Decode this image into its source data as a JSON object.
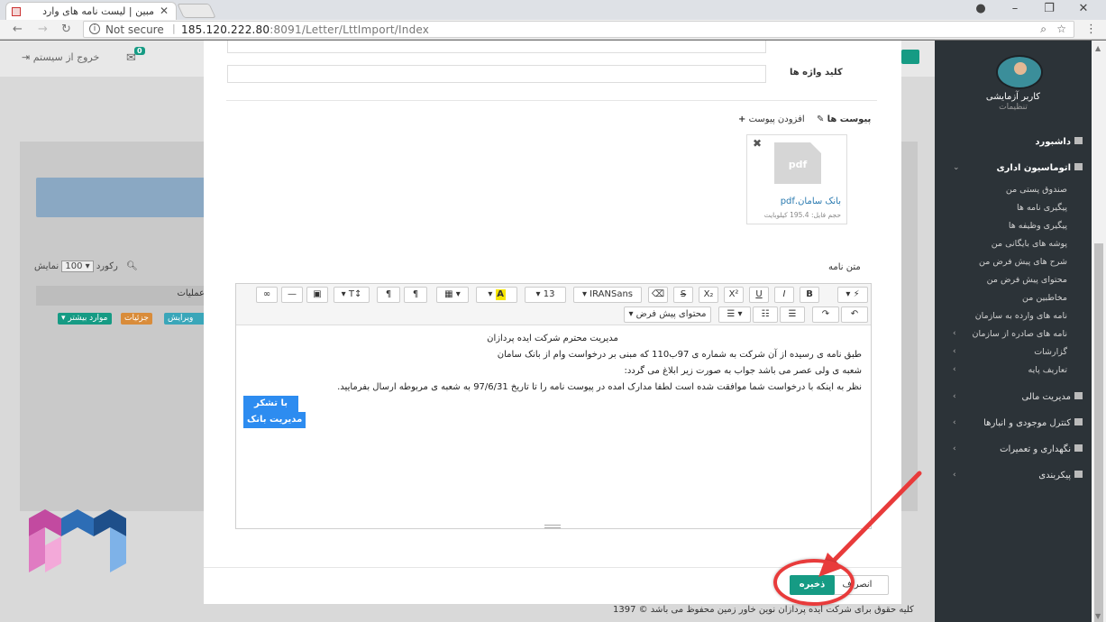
{
  "browser": {
    "tab_title": "مبین | لیست نامه های وارد",
    "tab_close": "✕",
    "not_secure": "Not secure",
    "url_host": "185.120.222.80",
    "url_rest": ":8091/Letter/LttImport/Index"
  },
  "topbar": {
    "logout": "خروج از سیستم",
    "badge": "0"
  },
  "sidebar": {
    "user_name": "کاربر آزمایشی",
    "user_sub": "تنظیمات",
    "items": {
      "dashboard": "داشبورد",
      "office": "اتوماسیون اداری",
      "postbox": "صندوق پستی من",
      "tracking": "پیگیری نامه ها",
      "task_tracking": "پیگیری وظیفه ها",
      "archive": "پوشه های بایگانی من",
      "default_desc": "شرح های پیش فرض من",
      "default_content": "محتوای پیش فرض من",
      "contacts": "مخاطبین من",
      "incoming": "نامه های وارده به سازمان",
      "outgoing": "نامه های صادره از سازمان",
      "reports": "گزارشات",
      "base_defs": "تعاریف پایه",
      "finance": "مدیریت مالی",
      "inventory": "کنترل موجودی و انبارها",
      "maintenance": "نگهداری و تعمیرات",
      "config": "پیکربندی"
    }
  },
  "background": {
    "show": "نمایش",
    "show_count": "100",
    "records": "رکورد",
    "ops_header": "عملیات",
    "edit": "ویرایش",
    "details": "جزئیات",
    "more": "موارد بیشتر",
    "footer_text": "کلیه حقوق برای شرکت ایده پردازان نوین خاور زمین محفوظ می باشد © 1397"
  },
  "modal": {
    "keywords_label": "کلید واژه ها",
    "attachments_label": "پیوست ها",
    "add_attachment": "افزودن پیوست",
    "file_badge": "pdf",
    "file_name": "بانک سامان.pdf",
    "file_size": "حجم فایل: 195.4 کیلوبایت",
    "letter_text_label": "متن نامه",
    "font_name": "IRANSans",
    "font_size": "13",
    "default_content_btn": "محتوای پیش فرض",
    "body": {
      "line1": "مدیریت محترم شرکت ایده پردازان",
      "line2": "طبق نامه ی رسیده از آن شرکت به شماره ی 97ب110 که مبنی بر درخواست وام از بانک سامان",
      "line3": "شعبه ی ولی عصر می باشد جواب به صورت زیر ابلاغ می گردد:",
      "line4": "نظر به اینکه با درخواست شما موافقت شده است لطفا مدارک امده در پیوست نامه را تا تاریخ 97/6/31 به شعبه ی مربوطه ارسال بفرمایید.",
      "line5": "با تشکر",
      "line6": "مدیریت بانک"
    },
    "cancel": "انصراف",
    "save": "ذخیره"
  },
  "colors": {
    "teal": "#169b84",
    "highlight": "#e83b3b",
    "sidebar": "#2c3338"
  }
}
